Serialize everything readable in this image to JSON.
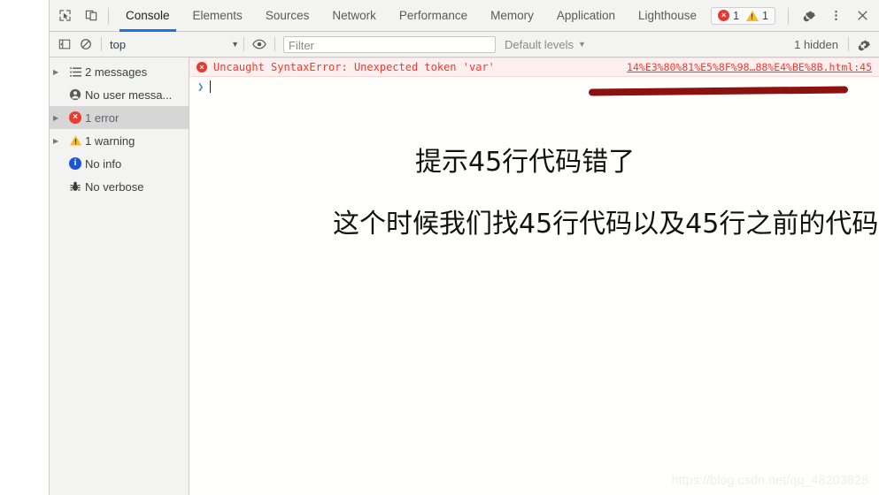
{
  "devtools": {
    "tabbar": {
      "inspect_icon": "inspect-element-icon",
      "device_icon": "device-toolbar-icon",
      "tabs": [
        {
          "label": "Console",
          "active": true
        },
        {
          "label": "Elements",
          "active": false
        },
        {
          "label": "Sources",
          "active": false
        },
        {
          "label": "Network",
          "active": false
        },
        {
          "label": "Performance",
          "active": false
        },
        {
          "label": "Memory",
          "active": false
        },
        {
          "label": "Application",
          "active": false
        },
        {
          "label": "Lighthouse",
          "active": false
        }
      ],
      "issues": {
        "error_count": "1",
        "warning_count": "1"
      },
      "settings_icon": "gear-icon",
      "more_icon": "kebab-menu-icon",
      "close_icon": "close-icon"
    },
    "filterbar": {
      "sidebar_toggle_icon": "show-console-sidebar-icon",
      "clear_icon": "clear-console-icon",
      "context_value": "top",
      "context_caret": "▼",
      "eye_icon": "live-expression-eye-icon",
      "filter_placeholder": "Filter",
      "filter_value": "",
      "levels_label": "Default levels",
      "levels_caret": "▼",
      "hidden_label": "1 hidden",
      "settings_icon": "console-settings-gear-icon"
    },
    "sidebar": {
      "items": [
        {
          "label": "2 messages",
          "icon": "list-icon",
          "arrow": true,
          "selected": false
        },
        {
          "label": "No user messa...",
          "icon": "user-icon",
          "arrow": false,
          "selected": false
        },
        {
          "label": "1 error",
          "icon": "error-icon",
          "arrow": true,
          "selected": true
        },
        {
          "label": "1 warning",
          "icon": "warning-icon",
          "arrow": true,
          "selected": false
        },
        {
          "label": "No info",
          "icon": "info-icon",
          "arrow": false,
          "selected": false
        },
        {
          "label": "No verbose",
          "icon": "verbose-bug-icon",
          "arrow": false,
          "selected": false
        }
      ]
    },
    "console": {
      "messages": [
        {
          "icon": "error-icon",
          "text": "Uncaught SyntaxError: Unexpected token 'var'",
          "source": "14%E3%80%81%E5%8F%98…88%E4%BE%8B.html:45"
        }
      ],
      "prompt_chevron": "❯",
      "prompt_value": ""
    }
  },
  "annotations": {
    "line1": "提示45行代码错了",
    "line2": "这个时候我们找45行代码以及45行之前的代码",
    "stroke_color": "#8c1212",
    "watermark": "https://blog.csdn.net/qq_48203828"
  }
}
